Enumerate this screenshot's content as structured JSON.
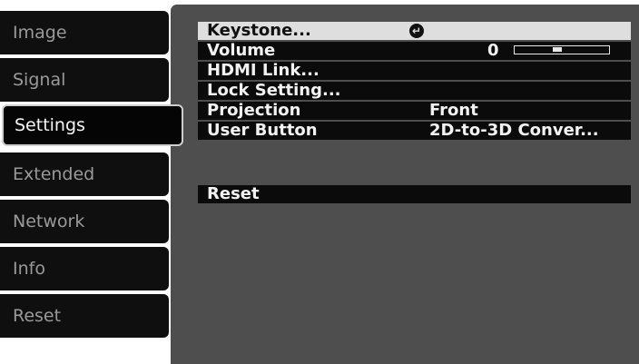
{
  "sidebar": {
    "tabs": [
      {
        "label": "Image"
      },
      {
        "label": "Signal"
      },
      {
        "label": "Settings",
        "active": true
      },
      {
        "label": "Extended"
      },
      {
        "label": "Network"
      },
      {
        "label": "Info"
      },
      {
        "label": "Reset"
      }
    ]
  },
  "settings_menu": {
    "keystone": {
      "label": "Keystone...",
      "icon": "enter-icon"
    },
    "volume": {
      "label": "Volume",
      "value": "0",
      "level": 0.45
    },
    "hdmi_link": {
      "label": "HDMI Link..."
    },
    "lock_setting": {
      "label": "Lock Setting..."
    },
    "projection": {
      "label": "Projection",
      "value": "Front"
    },
    "user_button": {
      "label": "User Button",
      "value": "2D-to-3D Conver..."
    },
    "reset": {
      "label": "Reset"
    }
  },
  "colors": {
    "panel": "#4e4e4e",
    "row": "#0b0b0b",
    "highlight": "#dedede",
    "tab": "#0f0f0f",
    "inactive_text": "#9a9a9a",
    "active_text": "#f5f5f5"
  }
}
